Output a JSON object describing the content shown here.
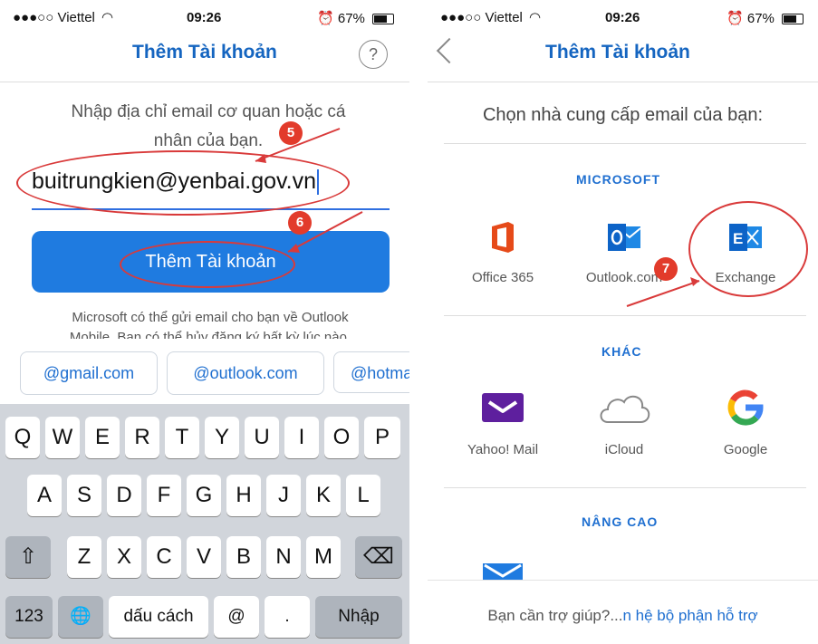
{
  "left": {
    "status": {
      "carrier": "●●●○○ Viettel",
      "time": "09:26",
      "battery": "67%"
    },
    "title": "Thêm Tài khoản",
    "help": "?",
    "prompt_line1": "Nhập địa chỉ email cơ quan hoặc cá",
    "prompt_line2": "nhân của bạn.",
    "email_value": "buitrungkien@yenbai.gov.vn",
    "add_button": "Thêm Tài khoản",
    "notice_line1": "Microsoft có thể gửi email cho bạn về Outlook",
    "notice_line2": "Mobile. Bạn có thể hủy đăng ký bất kỳ lúc nào.",
    "suggestions": [
      "@gmail.com",
      "@outlook.com",
      "@hotma"
    ],
    "badges": {
      "b5": "5",
      "b6": "6"
    },
    "keyboard": {
      "row1": [
        "Q",
        "W",
        "E",
        "R",
        "T",
        "Y",
        "U",
        "I",
        "O",
        "P"
      ],
      "row2": [
        "A",
        "S",
        "D",
        "F",
        "G",
        "H",
        "J",
        "K",
        "L"
      ],
      "row3": [
        "Z",
        "X",
        "C",
        "V",
        "B",
        "N",
        "M"
      ],
      "shift": "⇧",
      "backspace": "⌫",
      "num": "123",
      "globe": "🌐",
      "space": "dấu cách",
      "at": "@",
      "dot": ".",
      "enter": "Nhập"
    }
  },
  "right": {
    "status": {
      "carrier": "●●●○○ Viettel",
      "time": "09:26",
      "battery": "67%"
    },
    "title": "Thêm Tài khoản",
    "choose": "Chọn nhà cung cấp email của bạn:",
    "sections": {
      "microsoft": "MICROSOFT",
      "other": "KHÁC",
      "advanced": "NÂNG CAO"
    },
    "providers": {
      "office365": "Office 365",
      "outlook": "Outlook.com",
      "exchange": "Exchange",
      "yahoo": "Yahoo! Mail",
      "icloud": "iCloud",
      "google": "Google"
    },
    "badge7": "7",
    "footer_prefix": "Bạn cần trợ giúp?...",
    "footer_link": "n hệ bộ phận hỗ trợ"
  },
  "colors": {
    "accent": "#1f7be0",
    "annotation": "#e23b2b",
    "keyboard_bg": "#d1d5db"
  },
  "icons": [
    "help-icon",
    "back-chevron-icon",
    "office365-icon",
    "outlook-icon",
    "exchange-icon",
    "yahoo-mail-icon",
    "icloud-icon",
    "google-icon",
    "mail-icon",
    "shift-icon",
    "backspace-icon",
    "globe-icon",
    "battery-icon",
    "alarm-icon",
    "wifi-icon"
  ]
}
